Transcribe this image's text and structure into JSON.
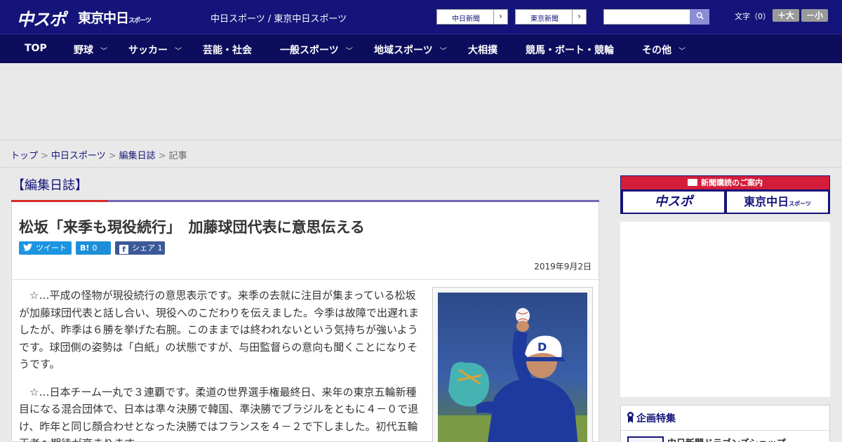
{
  "header": {
    "logo_chuspo": "中スポ",
    "logo_tokyo": "東京中日",
    "logo_tokyo_suffix": "スポーツ",
    "site_title": "中日スポーツ / 東京中日スポーツ",
    "links": [
      "中日新聞",
      "東京新聞"
    ],
    "font_size_label": "文字（0）",
    "font_larger": "＋大",
    "font_smaller": "－小"
  },
  "nav": {
    "items": [
      {
        "label": "TOP",
        "dropdown": false
      },
      {
        "label": "野球",
        "dropdown": true
      },
      {
        "label": "サッカー",
        "dropdown": true
      },
      {
        "label": "芸能・社会",
        "dropdown": false
      },
      {
        "label": "一般スポーツ",
        "dropdown": true
      },
      {
        "label": "地域スポーツ",
        "dropdown": true
      },
      {
        "label": "大相撲",
        "dropdown": false
      },
      {
        "label": "競馬・ボート・競輪",
        "dropdown": false
      },
      {
        "label": "その他",
        "dropdown": true
      }
    ]
  },
  "breadcrumb": [
    "トップ",
    "中日スポーツ",
    "編集日誌",
    "記事"
  ],
  "category": "【編集日誌】",
  "article": {
    "headline": "松坂「来季も現役続行」　加藤球団代表に意思伝える",
    "share": {
      "tweet": "ツイート",
      "hatena_mark": "B!",
      "hatena_count": "0",
      "facebook": "シェア",
      "facebook_count": "1"
    },
    "date": "2019年9月2日",
    "paragraphs": [
      "☆…平成の怪物が現役続行の意思表示です。来季の去就に注目が集まっている松坂が加藤球団代表と話し合い、現役へのこだわりを伝えました。今季は故障で出遅れましたが、昨季は６勝を挙げた右腕。このままでは終われないという気持ちが強いようです。球団側の姿勢は「白紙」の状態ですが、与田監督らの意向も聞くことになりそうです。",
      "☆…日本チーム一丸で３連覇です。柔道の世界選手権最終日、来年の東京五輪新種目になる混合団体で、日本は準々決勝で韓国、準決勝でブラジルをともに４－０で退け、昨年と同じ顔合わせとなった決勝ではフランスを４－２で下しました。初代五輪王者へ期待が高まります。"
    ]
  },
  "sidebar": {
    "promo_header": "新聞購読のご案内",
    "promo_chuspo": "中スポ",
    "promo_tokyo": "東京中日",
    "promo_tokyo_suffix": "スポーツ",
    "special_title": "企画特集",
    "special_item": "中日新聞ドラゴンズショップ"
  },
  "colors": {
    "brand_navy": "#14147a",
    "nav_navy": "#0d0d5e",
    "accent_red": "#d62a2a",
    "accent_purple": "#7466b5"
  }
}
